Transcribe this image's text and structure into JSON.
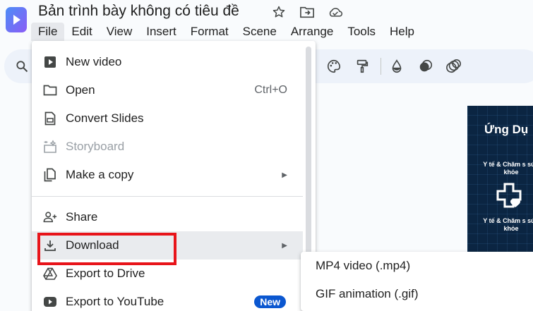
{
  "app": {
    "title": "Bản trình bày không có tiêu đề",
    "accent": "#0b57d0",
    "logo_icon": "vids-logo-icon"
  },
  "title_icons": [
    "star-icon",
    "move-to-folder-icon",
    "cloud-status-icon"
  ],
  "menubar": {
    "items": [
      "File",
      "Edit",
      "View",
      "Insert",
      "Format",
      "Scene",
      "Arrange",
      "Tools",
      "Help"
    ],
    "active": "File"
  },
  "toolbar": {
    "icons": [
      "search-icon",
      "palette-icon",
      "paint-format-icon",
      "fill-color-icon",
      "border-icon",
      "effects-icon"
    ]
  },
  "file_menu": {
    "items": [
      {
        "label": "New video",
        "icon": "video-icon"
      },
      {
        "label": "Open",
        "icon": "folder-icon",
        "shortcut": "Ctrl+O"
      },
      {
        "label": "Convert Slides",
        "icon": "slides-icon"
      },
      {
        "label": "Storyboard",
        "icon": "storyboard-icon",
        "disabled": true
      },
      {
        "label": "Make a copy",
        "icon": "copy-icon",
        "submenu": true
      },
      {
        "label": "Share",
        "icon": "share-person-icon"
      },
      {
        "label": "Download",
        "icon": "download-icon",
        "submenu": true,
        "highlighted": true
      },
      {
        "label": "Export to Drive",
        "icon": "drive-icon"
      },
      {
        "label": "Export to YouTube",
        "icon": "youtube-icon",
        "badge": "New"
      }
    ]
  },
  "download_submenu": {
    "items": [
      "MP4 video (.mp4)",
      "GIF animation (.gif)"
    ]
  },
  "slide_preview": {
    "heading": "Ứng Dụ",
    "caption_top": "Y tế & Chăm s sức khỏe",
    "caption_bottom": "Y tế & Chăm s sức khỏe"
  },
  "annotation": {
    "color": "#e8141a"
  }
}
